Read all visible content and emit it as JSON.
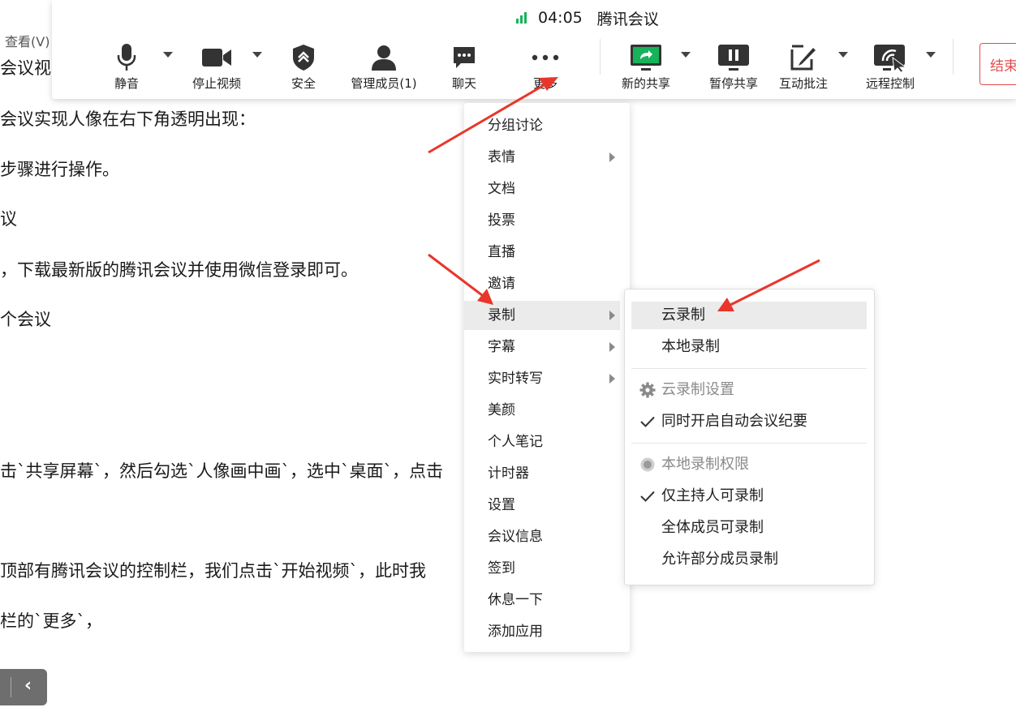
{
  "document": {
    "menu_text": "查看(V)",
    "lines": [
      "会议视",
      "会议实现人像在右下角透明出现：",
      "步骤进行操作。",
      "议",
      "，下载最新版的腾讯会议并使用微信登录即可。",
      "个会议",
      "击`共享屏幕`，然后勾选`人像画中画`，选中`桌面`，点击",
      "顶部有腾讯会议的控制栏，我们点击`开始视频`，此时我",
      "栏的`更多`，"
    ]
  },
  "toolbar": {
    "time": "04:05",
    "title": "腾讯会议",
    "buttons": {
      "mute": "静音",
      "stop_video": "停止视频",
      "security": "安全",
      "members": "管理成员(1)",
      "chat": "聊天",
      "more": "更多",
      "new_share": "新的共享",
      "pause_share": "暂停共享",
      "annotate": "互动批注",
      "remote_control": "远程控制",
      "end": "结束"
    },
    "colors": {
      "share_accent": "#16b35a",
      "signal": "#16b35a",
      "end": "#e34d4d"
    }
  },
  "more_menu": {
    "items": [
      "分组讨论",
      "表情",
      "文档",
      "投票",
      "直播",
      "邀请",
      "录制",
      "字幕",
      "实时转写",
      "美颜",
      "个人笔记",
      "计时器",
      "设置",
      "会议信息",
      "签到",
      "休息一下",
      "添加应用"
    ]
  },
  "record_submenu": {
    "cloud": "云录制",
    "local": "本地录制",
    "cloud_settings": "云录制设置",
    "auto_minutes": "同时开启自动会议纪要",
    "local_permission": "本地录制权限",
    "host_only": "仅主持人可录制",
    "all_members": "全体成员可录制",
    "partial_members": "允许部分成员录制"
  },
  "annotation_color": "#e8362b"
}
